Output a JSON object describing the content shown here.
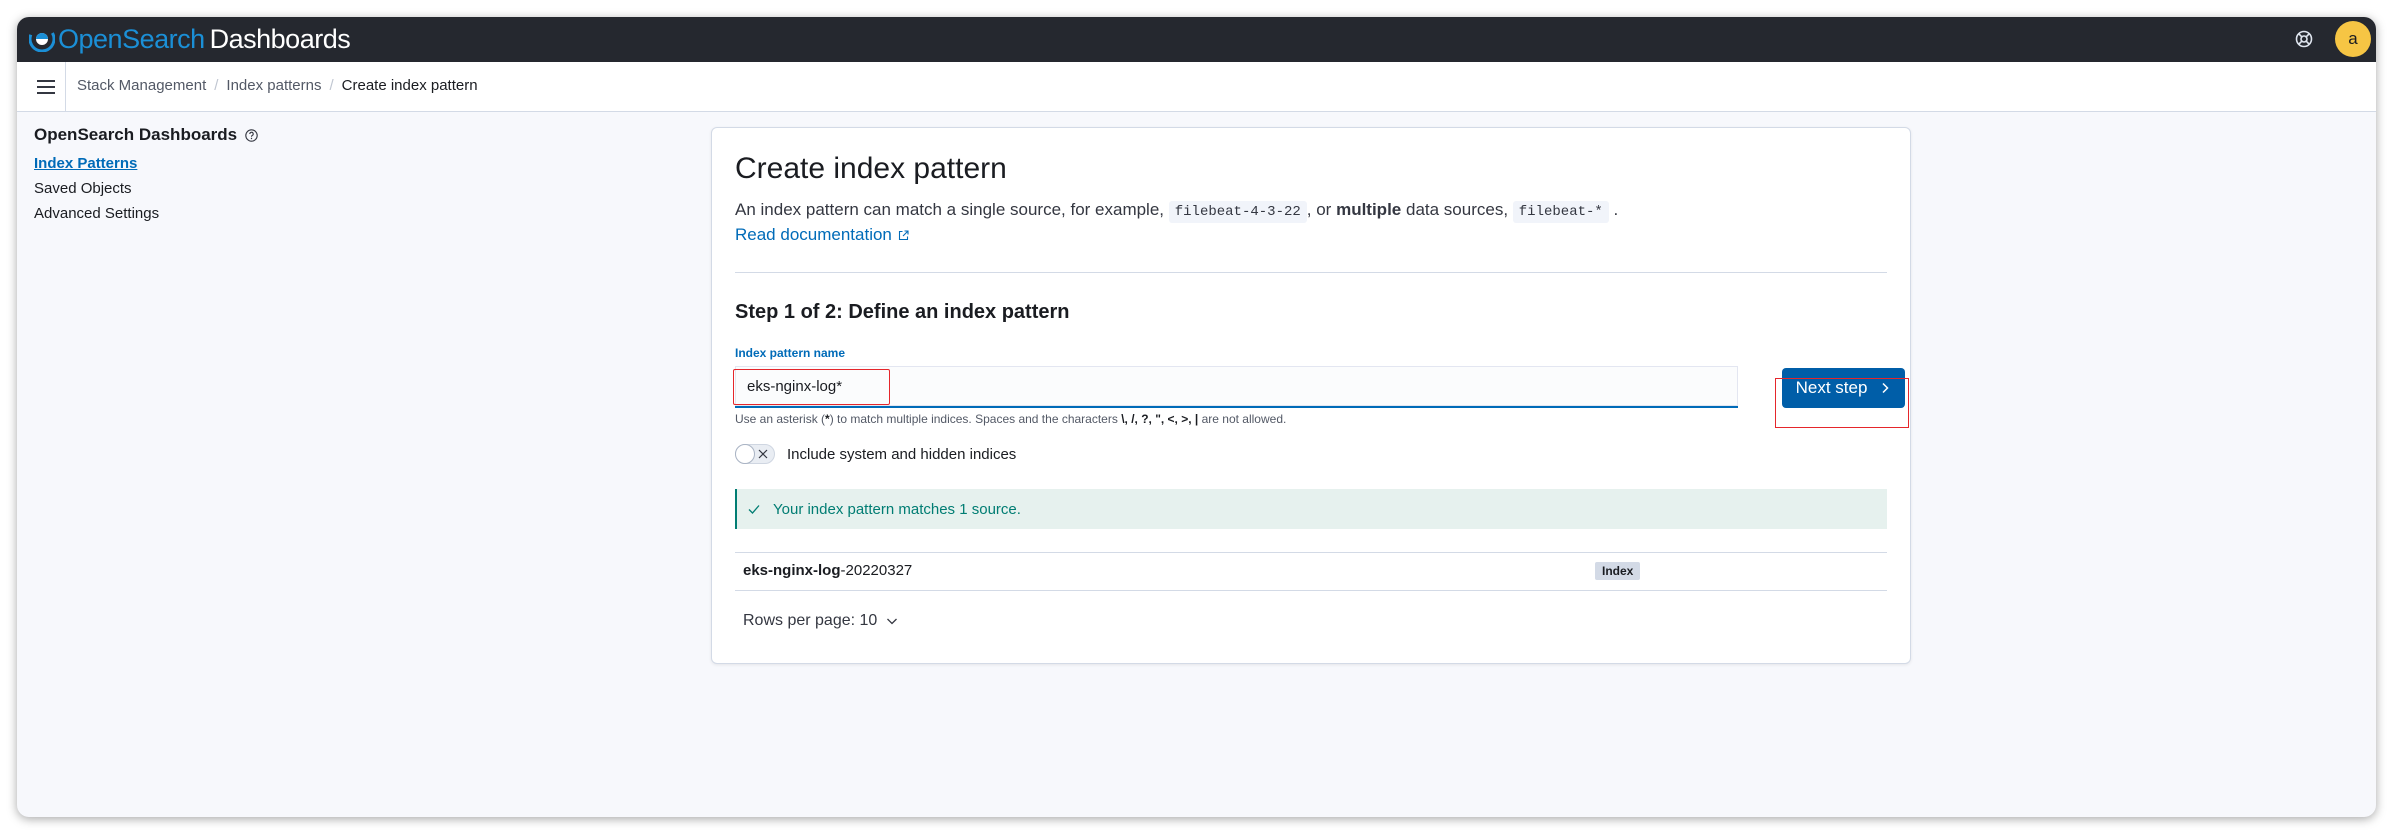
{
  "app": {
    "logo_open": "Open",
    "logo_search": "Search",
    "logo_dashboards": "Dashboards",
    "avatar_initial": "a"
  },
  "breadcrumbs": [
    "Stack Management",
    "Index patterns",
    "Create index pattern"
  ],
  "sidebar": {
    "title": "OpenSearch Dashboards",
    "items": [
      {
        "label": "Index Patterns",
        "active": true
      },
      {
        "label": "Saved Objects",
        "active": false
      },
      {
        "label": "Advanced Settings",
        "active": false
      }
    ]
  },
  "main": {
    "title": "Create index pattern",
    "desc_part1": "An index pattern can match a single source, for example,",
    "code1": "filebeat-4-3-22",
    "desc_part2": ", or",
    "desc_bold": "multiple",
    "desc_part3": "data sources,",
    "code2": "filebeat-*",
    "desc_part4": ".",
    "doc_link": "Read documentation",
    "step_title": "Step 1 of 2: Define an index pattern",
    "field_label": "Index pattern name",
    "input_value": "eks-nginx-log*",
    "next_button": "Next step",
    "help_part1": "Use an asterisk (",
    "help_asterisk": "*",
    "help_part2": ") to match multiple indices. Spaces and the characters",
    "help_chars": "\\, /, ?, \", <, >, |",
    "help_part3": "are not allowed.",
    "toggle_label": "Include system and hidden indices",
    "match_message": "Your index pattern matches 1 source.",
    "result_row": {
      "name_bold": "eks-nginx-log",
      "name_rest": "-20220327",
      "badge": "Index"
    },
    "rows_per_page": "Rows per page: 10"
  },
  "colors": {
    "topbar": "#25282f",
    "accent": "#006bb8",
    "button": "#005ea8",
    "success": "#017d73",
    "highlight": "#e5262b"
  }
}
